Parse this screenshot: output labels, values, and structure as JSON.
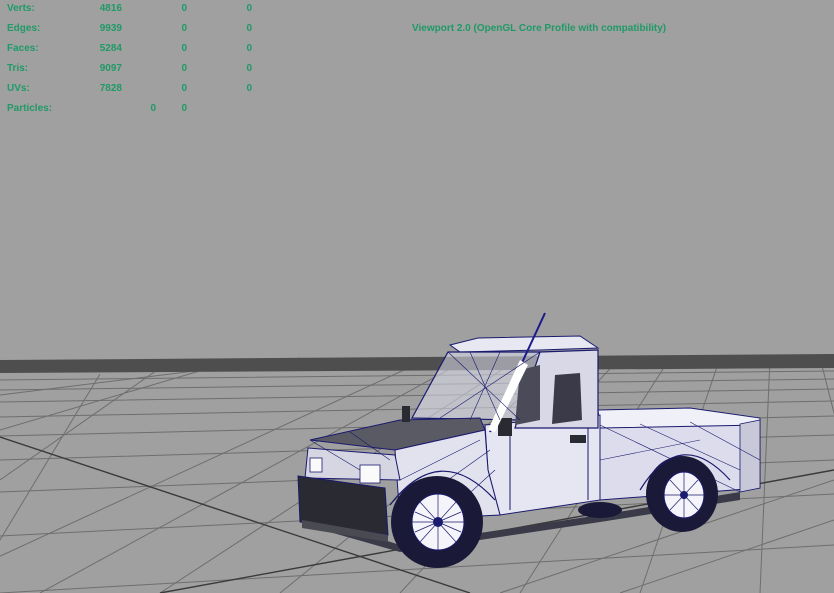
{
  "hud": {
    "rows": [
      {
        "label": "Verts:",
        "values": [
          "4816",
          "0",
          "0"
        ]
      },
      {
        "label": "Edges:",
        "values": [
          "9939",
          "0",
          "0"
        ]
      },
      {
        "label": "Faces:",
        "values": [
          "5284",
          "0",
          "0"
        ]
      },
      {
        "label": "Tris:",
        "values": [
          "9097",
          "0",
          "0"
        ]
      },
      {
        "label": "UVs:",
        "values": [
          "7828",
          "0",
          "0"
        ]
      }
    ],
    "particles": {
      "label": "Particles:",
      "values": [
        "0",
        "0"
      ]
    },
    "renderer": "Viewport 2.0 (OpenGL Core Profile with compatibility)",
    "text_color": "#1f9a68"
  },
  "scene": {
    "background_color": "#a0a0a0",
    "grid_color": "#6e6e6e",
    "axis_color": "#3a3a3a",
    "wireframe_color": "#1a1a6e",
    "model": "pickup-truck-wireframe"
  }
}
